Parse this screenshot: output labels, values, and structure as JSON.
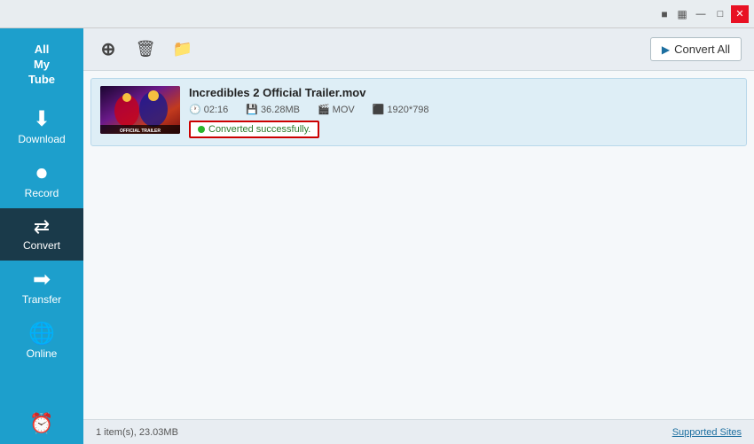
{
  "titlebar": {
    "tray_icons": [
      "■",
      "▦"
    ],
    "min_label": "—",
    "max_label": "□",
    "close_label": "✕"
  },
  "sidebar": {
    "logo_line1": "All",
    "logo_line2": "My",
    "logo_line3": "Tube",
    "items": [
      {
        "id": "download",
        "label": "Download",
        "icon": "⬇"
      },
      {
        "id": "record",
        "label": "Record",
        "icon": "⏺"
      },
      {
        "id": "convert",
        "label": "Convert",
        "icon": "↔"
      },
      {
        "id": "transfer",
        "label": "Transfer",
        "icon": "➡"
      },
      {
        "id": "online",
        "label": "Online",
        "icon": "🌐"
      }
    ],
    "bottom_icon": "⏰"
  },
  "toolbar": {
    "add_tooltip": "Add",
    "delete_tooltip": "Delete",
    "folder_tooltip": "Open folder",
    "convert_all_label": "Convert All",
    "convert_icon": "▶"
  },
  "file_list": {
    "items": [
      {
        "id": "file1",
        "name": "Incredibles 2 Official Trailer.mov",
        "duration": "02:16",
        "size": "36.28MB",
        "format": "MOV",
        "resolution": "1920*798",
        "status": "Converted successfully.",
        "thumb_alt": "Incredibles 2 Official Trailer"
      }
    ]
  },
  "statusbar": {
    "info": "1 item(s), 23.03MB",
    "supported_sites_label": "Supported Sites"
  }
}
